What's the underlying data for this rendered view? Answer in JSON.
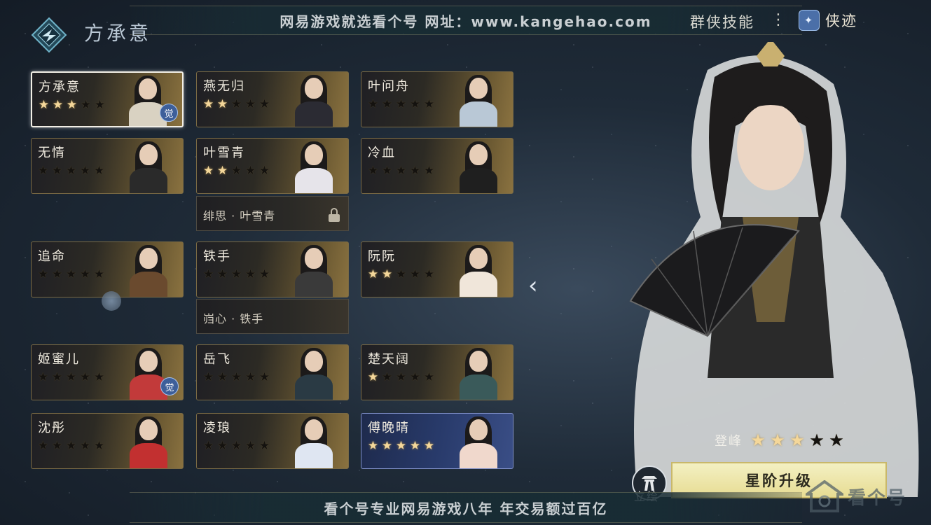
{
  "header": {
    "hero_name": "方承意",
    "banner_top": "网易游戏就选看个号  网址：www.kangehao.com",
    "skill_link": "群侠技能",
    "menu_dots": "⋮",
    "deeds_label": "侠迹",
    "deeds_icon": "deeds-icon"
  },
  "roster": [
    {
      "name": "方承意",
      "stars": 3,
      "selected": true,
      "awakened": true,
      "style": "gold"
    },
    {
      "name": "燕无归",
      "stars": 2,
      "style": "gold"
    },
    {
      "name": "叶问舟",
      "stars": 0,
      "style": "gold"
    },
    {
      "name": "无情",
      "stars": 0,
      "style": "gold"
    },
    {
      "name": "叶雪青",
      "stars": 2,
      "style": "gold"
    },
    {
      "name": "冷血",
      "stars": 0,
      "style": "gold"
    },
    {
      "name": "追命",
      "stars": 0,
      "style": "gold"
    },
    {
      "name": "铁手",
      "stars": 0,
      "style": "gold"
    },
    {
      "name": "阮阮",
      "stars": 2,
      "style": "gold"
    },
    {
      "name": "姬蜜儿",
      "stars": 0,
      "awakened": true,
      "style": "gold"
    },
    {
      "name": "岳飞",
      "stars": 0,
      "style": "gold"
    },
    {
      "name": "楚天阔",
      "stars": 1,
      "style": "gold"
    },
    {
      "name": "沈彤",
      "stars": 0,
      "style": "gold"
    },
    {
      "name": "凌琅",
      "stars": 0,
      "style": "gold"
    },
    {
      "name": "傅晚晴",
      "stars": 5,
      "style": "blue"
    }
  ],
  "skins": [
    {
      "name": "绯思 · 叶雪青",
      "locked": true
    },
    {
      "name": "岿心 · 铁手",
      "locked": false
    }
  ],
  "awaken_badge": "觉",
  "detail": {
    "rank_label": "登峰",
    "rank_stars": 3,
    "rank_max": 5,
    "upgrade_button": "星阶升级",
    "portrait_button": "立绘"
  },
  "footer": {
    "banner_bottom": "看个号专业网易游戏八年  年交易额过百亿"
  },
  "watermark": "看个号",
  "colors": {
    "star_on": "#f4d79a",
    "accent": "#e7dc93"
  }
}
